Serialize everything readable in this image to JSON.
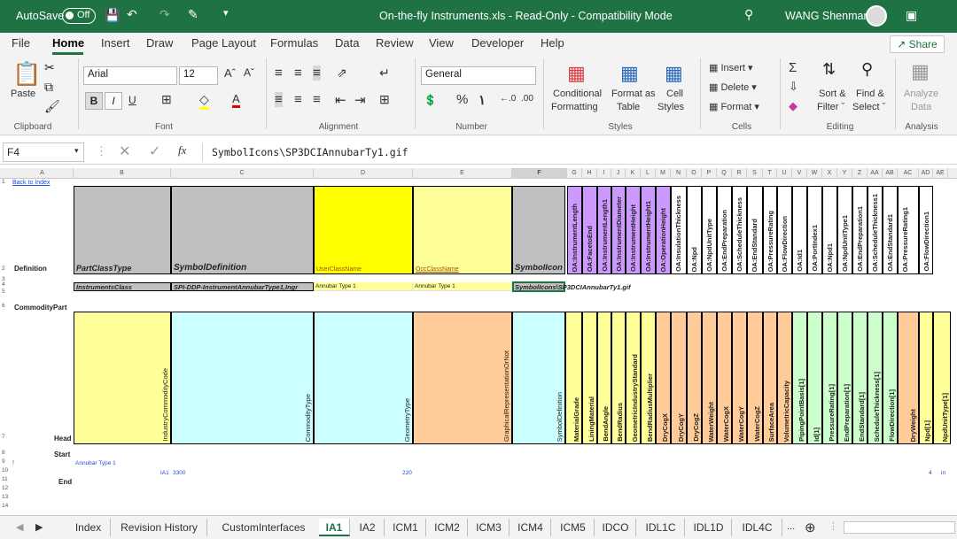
{
  "titlebar": {
    "autosave_label": "AutoSave",
    "autosave_state": "Off",
    "document_title": "On-the-fly Instruments.xls - Read-Only - Compatibility Mode",
    "user_name": "WANG Shenman",
    "bg_color": "#1f7244"
  },
  "menu": {
    "tabs": [
      "File",
      "Home",
      "Insert",
      "Draw",
      "Page Layout",
      "Formulas",
      "Data",
      "Review",
      "View",
      "Developer",
      "Help"
    ],
    "active": "Home",
    "share_label": "Share"
  },
  "ribbon": {
    "clipboard": {
      "paste": "Paste",
      "group": "Clipboard"
    },
    "font": {
      "name": "Arial",
      "size": "12",
      "bold": "B",
      "italic": "I",
      "underline": "U",
      "group": "Font"
    },
    "alignment": {
      "group": "Alignment"
    },
    "number": {
      "format": "General",
      "group": "Number"
    },
    "styles": {
      "conditional": "Conditional",
      "formatting": "Formatting",
      "format_as": "Format as",
      "table": "Table",
      "cell": "Cell",
      "styles": "Styles",
      "group": "Styles"
    },
    "cells": {
      "insert": "Insert",
      "delete": "Delete",
      "format": "Format",
      "group": "Cells"
    },
    "editing": {
      "sort": "Sort &",
      "filter": "Filter",
      "find": "Find &",
      "select": "Select",
      "group": "Editing"
    },
    "analysis": {
      "analyze": "Analyze",
      "data": "Data",
      "group": "Analysis"
    }
  },
  "formula_bar": {
    "name_box": "F4",
    "fx": "fx",
    "formula": "SymbolIcons\\SP3DCIAnnubarTy1.gif"
  },
  "columns": [
    "A",
    "B",
    "C",
    "D",
    "E",
    "F",
    "G",
    "H",
    "I",
    "J",
    "K",
    "L",
    "M",
    "N",
    "O",
    "P",
    "Q",
    "R",
    "S",
    "T",
    "U",
    "V",
    "W",
    "X",
    "Y",
    "Z",
    "AA",
    "AB",
    "AC",
    "AD",
    "AE"
  ],
  "selected_column": "F",
  "rows": [
    "1",
    "2",
    "3",
    "4",
    "5",
    "6",
    "7",
    "8",
    "9",
    "10",
    "11",
    "12",
    "13",
    "14"
  ],
  "sheet": {
    "back_to_index": "Back to Index",
    "definition": "Definition",
    "commodity_part": "CommodityPart",
    "head": "Head",
    "start": "Start",
    "end": "End",
    "row2_headers": [
      "PartClassType",
      "SymbolDefinition",
      "UserClassName",
      "OccClassName",
      "SymbolIcon"
    ],
    "row2_vertical": [
      "OA:InstrumentLength",
      "OA:FacetoEnd",
      "OA:InstrumentLength1",
      "OA:InstrumentDiameter",
      "OA:InstrumentHeight",
      "OA:InstrumentHeight1",
      "OA:OperationHeight",
      "OA:InsulationThickness",
      "OA:Npd",
      "OA:NpdUnitType",
      "OA:EndPreparation",
      "OA:ScheduleThickness",
      "OA:EndStandard",
      "OA:PressureRating",
      "OA:FlowDirection",
      "OA:Id1",
      "OA:PortIndex1",
      "OA:Npd1",
      "OA:NpdUnitType1",
      "OA:EndPreparation1",
      "OA:ScheduleThickness1",
      "OA:EndStandard1",
      "OA:PressureRating1",
      "OA:FlowDirection1"
    ],
    "row4": {
      "part_class": "InstrumentsClass",
      "symbol_def": "SPI-DDP-InstrumentAnnubarType1,Ingr",
      "user_class": "Annubar Type 1",
      "occ_class": "Annubar Type 1",
      "symbol_icon": "SymbolIcons\\SP3DCIAnnubarTy1.gif"
    },
    "row7_vertical": [
      "IndustryCommodityCode",
      "CommodityType",
      "GeometryType",
      "GraphicalRepresentationOrNot",
      "SymbolDefinition",
      "MaterialGrade",
      "LiningMaterial",
      "BendAngle",
      "BendRadius",
      "GeometricIndustryStandard",
      "BendRadiusMultiplier",
      "DryCogX",
      "DryCogY",
      "DryCogZ",
      "WaterWeight",
      "WaterCogX",
      "WaterCogY",
      "WaterCogZ",
      "SurfaceArea",
      "VolumetricCapacity",
      "PipingPointBasis[1]",
      "Id[1]",
      "PressureRating[1]",
      "EndPreparation[1]",
      "EndStandard[1]",
      "ScheduleThickness[1]",
      "FlowDirection[1]",
      "DryWeight",
      "Npd[1]",
      "NpdUnitType[1]"
    ],
    "row9": {
      "a": "!",
      "b": "Annubar Type 1"
    },
    "row10": {
      "b": "IA1",
      "c": "3300",
      "d": "220",
      "ad": "4",
      "ae": "in"
    }
  },
  "sheet_tabs": [
    "Index",
    "Revision History",
    "CustomInterfaces",
    "IA1",
    "IA2",
    "ICM1",
    "ICM2",
    "ICM3",
    "ICM4",
    "ICM5",
    "IDCO",
    "IDL1C",
    "IDL1D",
    "IDL4C"
  ],
  "active_sheet": "IA1",
  "more_tabs": "..."
}
